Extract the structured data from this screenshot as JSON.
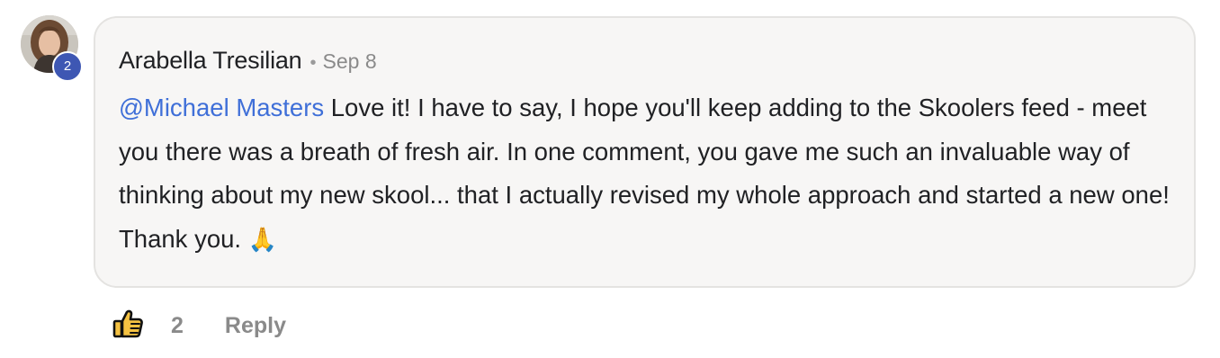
{
  "comment": {
    "author": "Arabella Tresilian",
    "separator": "•",
    "date": "Sep 8",
    "level": "2",
    "mention": "@Michael Masters",
    "text": " Love it! I have to say, I hope you'll keep adding to the Skoolers feed - meet you there was a breath of fresh air. In one comment, you gave me such an invaluable way of thinking about my new skool... that I actually revised my whole approach and started a new one! Thank you. ",
    "emoji": "🙏"
  },
  "actions": {
    "like_icon": "thumbs-up-icon",
    "like_count": "2",
    "reply_label": "Reply"
  },
  "colors": {
    "mention": "#3f6fd8",
    "badge": "#3e57b3",
    "like_icon": "#f5c242",
    "bubble": "#f7f6f5"
  }
}
